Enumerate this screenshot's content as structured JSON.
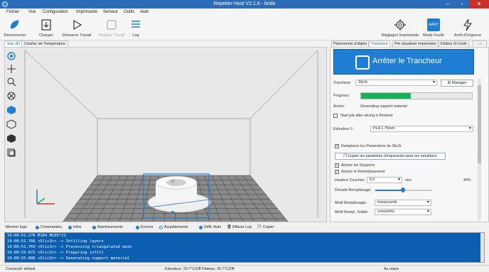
{
  "window": {
    "title": "Repetier-Host V2.1.6 - bride"
  },
  "menu": [
    "Fichier",
    "Vue",
    "Configuration",
    "Imprimante",
    "Serveur",
    "Outils",
    "Aide"
  ],
  "toolbar": {
    "disconnect": "Déconnecter",
    "load": "Charger",
    "start_job": "Démarrer Travail",
    "stop_job": "Stopper Travail",
    "log": "Log",
    "printer_settings": "Réglages Imprimante",
    "easy_mode": "Mode Facile",
    "easy_badge": "EASY",
    "emergency_stop": "Arrêt d'Urgence"
  },
  "left_tabs": [
    "Vue 3D",
    "Courbe de Température"
  ],
  "right_tabs": [
    "Placements d'objets",
    "Trancheur",
    "Pré visualiser impression",
    "Editeur G-Code"
  ],
  "slicer": {
    "kill_label": "Arrêter le Trancheur",
    "slicer_label": "Trancheur:",
    "slicer_value": "Slic3r",
    "manage_label": "Manager",
    "progress_label": "Progress:",
    "progress_value": 0.45,
    "action_label": "Action:",
    "action_value": "Generating support material",
    "start_after": "Start job after slicing is finished",
    "extruder_label": "Extrudeur 1:",
    "extruder_value": "PLA 1.75mm",
    "override": "Remplacer les Paramètres de Slic3r",
    "copy_button": "Copier les paramètre d'impression pour les remplacer",
    "supports": "Activer les Supports",
    "cooling": "Activer le Refroidissement",
    "layer_height_label": "Hauteur Couches:",
    "layer_height_value": "0.2",
    "layer_height_unit": "mm",
    "infill_density_label": "Densité Remplissage:",
    "infill_density_percent": "40%",
    "infill_density_value": 0.4,
    "fill_pattern_label": "Motif Remplissage:",
    "fill_pattern_value": "honeycomb",
    "solid_pattern_label": "Motif Rempl. Solide:",
    "solid_pattern_value": "concentric"
  },
  "log": {
    "filter_label": "Montrer logs:",
    "filters": [
      "Commandes",
      "Infos",
      "Avertissements",
      "Erreurs",
      "Acquittements",
      "Défil. Auto"
    ],
    "clear_label": "Effacer Log",
    "copy_label": "Copier",
    "lines": [
      "19:00:51.276 M104 M105*21",
      "19:00:51.766 <Slic3r> -> Infilling layers",
      "19:00:51.769 <Slic3r> -> Processing triangulated mesh",
      "19:00:53.072 <Slic3r> -> Preparing infill",
      "19:00:53.806 <Slic3r> -> Generating support material"
    ]
  },
  "status": {
    "connection": "Connecté: default",
    "temps": "Extrudeur: 29.7°C/Off Plateau: 29.7°C/Off",
    "state": "Au repos"
  },
  "colors": {
    "accent": "#1f7ed1",
    "progress": "#17b35a",
    "log_bg": "#0c5fb0",
    "close": "#c8302a"
  }
}
